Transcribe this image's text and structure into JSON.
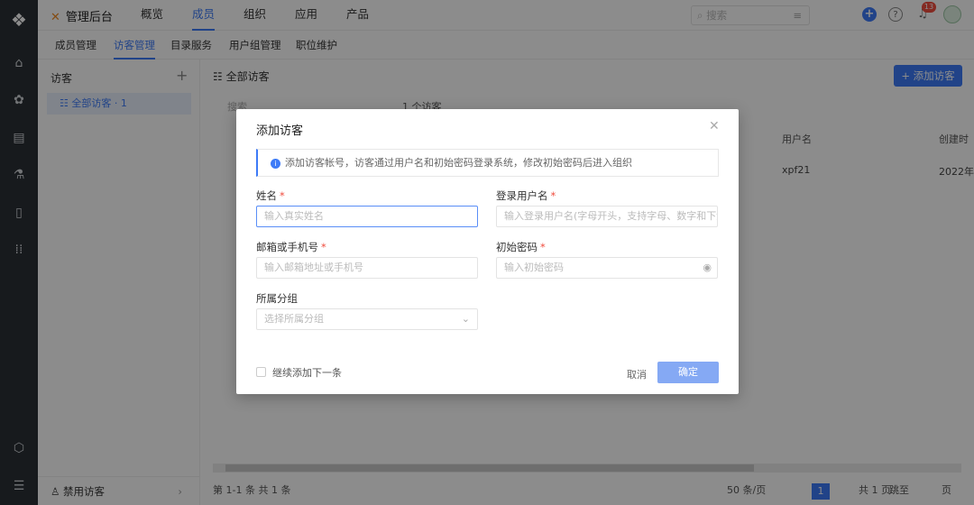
{
  "app": {
    "title": "管理后台"
  },
  "topnav": [
    {
      "label": "概览"
    },
    {
      "label": "成员"
    },
    {
      "label": "组织"
    },
    {
      "label": "应用"
    },
    {
      "label": "产品"
    }
  ],
  "search": {
    "placeholder": "搜索"
  },
  "notifications": {
    "count": "13"
  },
  "subnav": [
    {
      "label": "成员管理"
    },
    {
      "label": "访客管理"
    },
    {
      "label": "目录服务"
    },
    {
      "label": "用户组管理"
    },
    {
      "label": "职位维护"
    }
  ],
  "left_panel": {
    "title": "访客",
    "selected_item": "全部访客 · 1",
    "footer": "禁用访客"
  },
  "main": {
    "title": "全部访客",
    "add_button": "添加访客",
    "filter_placeholder": "搜索",
    "count_text": "1 个访客",
    "columns": {
      "username": "用户名",
      "created": "创建时"
    },
    "row": {
      "username": "xpf21",
      "created": "2022年"
    },
    "pager": {
      "summary": "第 1-1 条  共 1 条",
      "page_size": "50 条/页",
      "current_page": "1",
      "total_pages": "共 1 页",
      "jump": "跳至",
      "page_suffix": "页"
    }
  },
  "modal": {
    "title": "添加访客",
    "info": "添加访客帐号，访客通过用户名和初始密码登录系统，修改初始密码后进入组织",
    "fields": {
      "name": {
        "label": "姓名",
        "placeholder": "输入真实姓名"
      },
      "username": {
        "label": "登录用户名",
        "placeholder": "输入登录用户名(字母开头，支持字母、数字和下划..."
      },
      "contact": {
        "label": "邮箱或手机号",
        "placeholder": "输入邮箱地址或手机号"
      },
      "password": {
        "label": "初始密码",
        "placeholder": "输入初始密码"
      },
      "group": {
        "label": "所属分组",
        "placeholder": "选择所属分组"
      }
    },
    "continue_label": "继续添加下一条",
    "cancel": "取消",
    "confirm": "确定",
    "required_mark": "*"
  }
}
